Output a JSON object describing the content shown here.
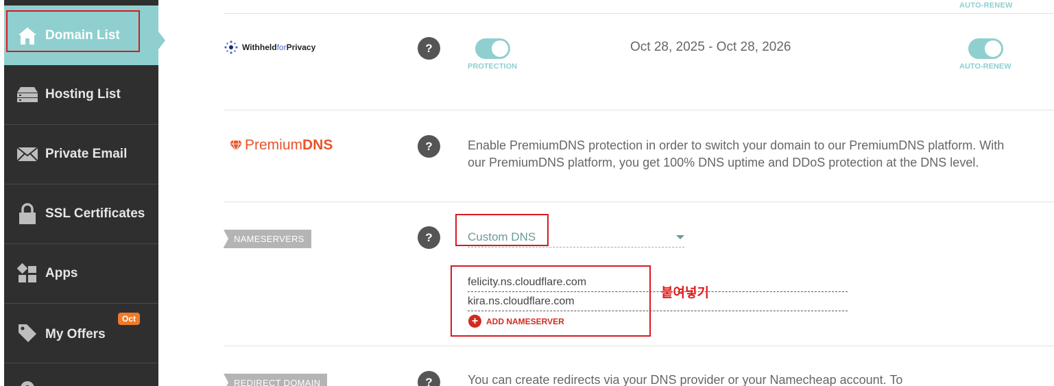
{
  "sidebar": {
    "items": [
      {
        "label": "Domain List",
        "icon": "home-icon"
      },
      {
        "label": "Hosting List",
        "icon": "server-icon"
      },
      {
        "label": "Private Email",
        "icon": "envelope-icon"
      },
      {
        "label": "SSL Certificates",
        "icon": "lock-icon"
      },
      {
        "label": "Apps",
        "icon": "apps-icon"
      },
      {
        "label": "My Offers",
        "icon": "tag-icon",
        "badge": "Oct"
      }
    ]
  },
  "header_row": {
    "auto_renew_label": "AUTO-RENEW"
  },
  "privacy_row": {
    "brand_bold": "Withheld",
    "brand_light": "for",
    "brand_end": "Privacy",
    "help": "?",
    "protection_label": "PROTECTION",
    "date_range": "Oct 28, 2025 - Oct 28, 2026",
    "auto_renew_label": "AUTO-RENEW"
  },
  "premium_row": {
    "brand_light": "Premium",
    "brand_bold": "DNS",
    "help": "?",
    "description": "Enable PremiumDNS protection in order to switch your domain to our PremiumDNS platform. With our PremiumDNS platform, you get 100% DNS uptime and DDoS protection at the DNS level."
  },
  "nameservers_row": {
    "label": "NAMESERVERS",
    "help": "?",
    "selected_option": "Custom DNS",
    "nameservers": [
      "felicity.ns.cloudflare.com",
      "kira.ns.cloudflare.com"
    ],
    "add_label": "ADD NAMESERVER",
    "annotation": "붙여넣기"
  },
  "redirect_row": {
    "label": "REDIRECT DOMAIN",
    "help": "?",
    "description": "You can create redirects via your DNS provider or your Namecheap account. To"
  },
  "colors": {
    "sidebar_bg": "#2f2f2f",
    "active_bg": "#8fcfcf",
    "accent_red": "#d71920",
    "premium_orange": "#e8542a"
  }
}
